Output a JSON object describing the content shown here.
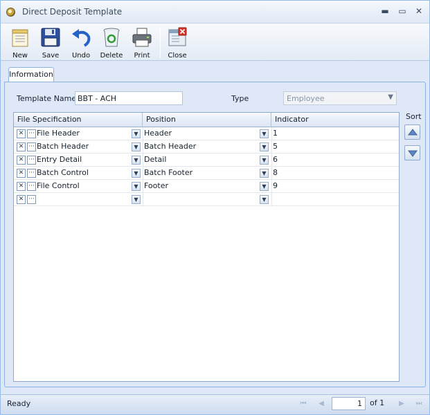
{
  "window": {
    "title": "Direct Deposit Template",
    "minimize": "▬",
    "maximize": "▭",
    "close": "✕"
  },
  "toolbar": {
    "new_label": "New",
    "save_label": "Save",
    "undo_label": "Undo",
    "delete_label": "Delete",
    "print_label": "Print",
    "close_label": "Close"
  },
  "tabs": [
    {
      "label": "Information",
      "active": true
    }
  ],
  "form": {
    "template_name_label": "Template Name",
    "template_name_value": "BBT - ACH",
    "type_label": "Type",
    "type_value": "Employee"
  },
  "grid": {
    "columns": [
      "File Specification",
      "Position",
      "Indicator"
    ],
    "rows": [
      {
        "file_spec": "File Header",
        "position": "Header",
        "indicator": "1"
      },
      {
        "file_spec": "Batch Header",
        "position": "Batch Header",
        "indicator": "5"
      },
      {
        "file_spec": "Entry Detail",
        "position": "Detail",
        "indicator": "6"
      },
      {
        "file_spec": "Batch Control",
        "position": "Batch Footer",
        "indicator": "8"
      },
      {
        "file_spec": "File Control",
        "position": "Footer",
        "indicator": "9"
      },
      {
        "file_spec": "",
        "position": "",
        "indicator": ""
      }
    ]
  },
  "sort": {
    "label": "Sort"
  },
  "statusbar": {
    "status": "Ready",
    "page": "1",
    "of_text": "of 1"
  },
  "icons": {
    "new": "new-document-icon",
    "save": "floppy-disk-icon",
    "undo": "undo-arrow-icon",
    "delete": "recycle-bin-icon",
    "print": "printer-icon",
    "close": "close-window-icon"
  }
}
